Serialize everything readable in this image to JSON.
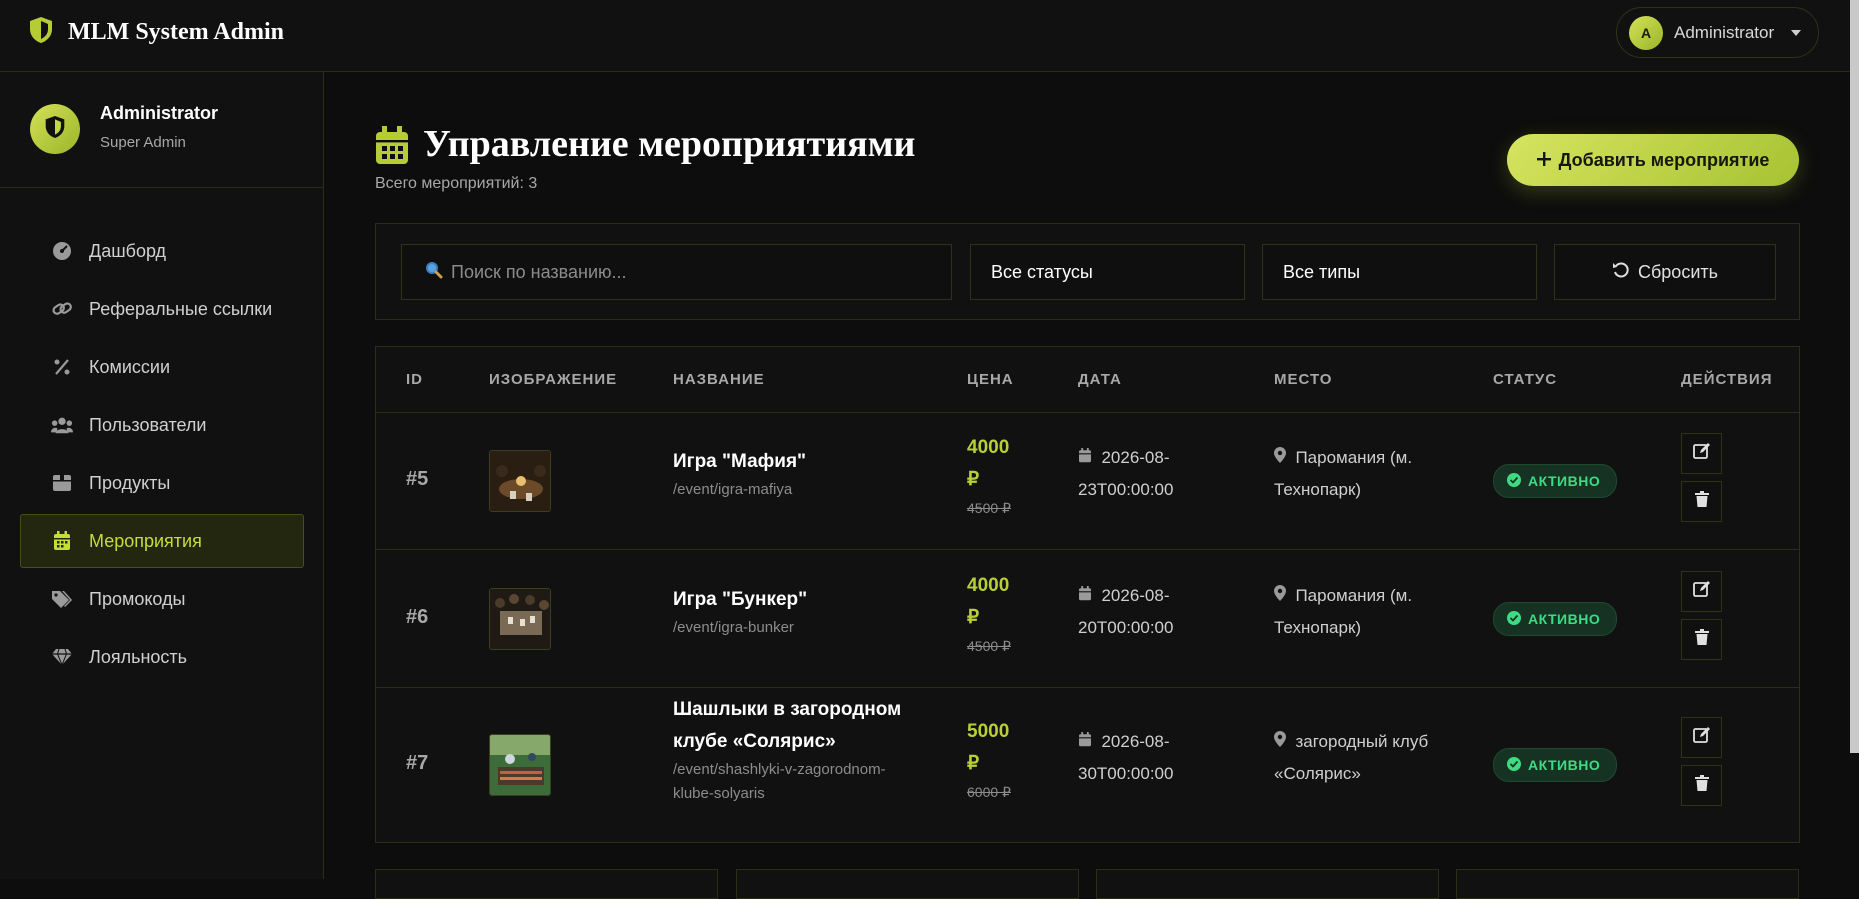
{
  "header": {
    "brand_title": "MLM System Admin",
    "user_initial": "A",
    "user_name": "Administrator"
  },
  "sidebar": {
    "profile_name": "Administrator",
    "profile_role": "Super Admin",
    "items": [
      {
        "label": "Дашборд",
        "icon": "dashboard-icon"
      },
      {
        "label": "Реферальные ссылки",
        "icon": "link-icon"
      },
      {
        "label": "Комиссии",
        "icon": "percent-icon"
      },
      {
        "label": "Пользователи",
        "icon": "users-icon"
      },
      {
        "label": "Продукты",
        "icon": "box-icon"
      },
      {
        "label": "Мероприятия",
        "icon": "calendar-icon",
        "active": true
      },
      {
        "label": "Промокоды",
        "icon": "tags-icon"
      },
      {
        "label": "Лояльность",
        "icon": "gem-icon"
      }
    ]
  },
  "page": {
    "title": "Управление мероприятиями",
    "subtitle": "Всего мероприятий: 3",
    "add_button": "Добавить мероприятие"
  },
  "filters": {
    "search_placeholder": "Поиск по названию...",
    "status_value": "Все статусы",
    "type_value": "Все типы",
    "reset_label": "Сбросить"
  },
  "table": {
    "headers": [
      "ID",
      "ИЗОБРАЖЕНИЕ",
      "НАЗВАНИЕ",
      "ЦЕНА",
      "ДАТА",
      "МЕСТО",
      "СТАТУС",
      "ДЕЙСТВИЯ"
    ],
    "rows": [
      {
        "id": "#5",
        "name": "Игра \"Мафия\"",
        "slug": "/event/igra-mafiya",
        "price": "4000",
        "currency": "₽",
        "old_price": "4500 ₽",
        "date_1": "2026-08-",
        "date_2": "23T00:00:00",
        "place_1": "Паромания (м.",
        "place_2": "Технопарк)",
        "status": "АКТИВНО"
      },
      {
        "id": "#6",
        "name": "Игра \"Бункер\"",
        "slug": "/event/igra-bunker",
        "price": "4000",
        "currency": "₽",
        "old_price": "4500 ₽",
        "date_1": "2026-08-",
        "date_2": "20T00:00:00",
        "place_1": "Паромания (м.",
        "place_2": "Технопарк)",
        "status": "АКТИВНО"
      },
      {
        "id": "#7",
        "name_1": "Шашлыки в загородном",
        "name_2": "клубе «Солярис»",
        "slug_1": "/event/shashlyki-v-zagorodnom-",
        "slug_2": "klube-solyaris",
        "price": "5000",
        "currency": "₽",
        "old_price": "6000 ₽",
        "date_1": "2026-08-",
        "date_2": "30T00:00:00",
        "place_1": "загородный клуб",
        "place_2": "«Солярис»",
        "status": "АКТИВНО"
      }
    ]
  },
  "colors": {
    "accent": "#c6dc3c",
    "background": "#0d0d0d",
    "panel": "#111111",
    "border": "#2a2f14",
    "status_green": "#3fdb83"
  }
}
